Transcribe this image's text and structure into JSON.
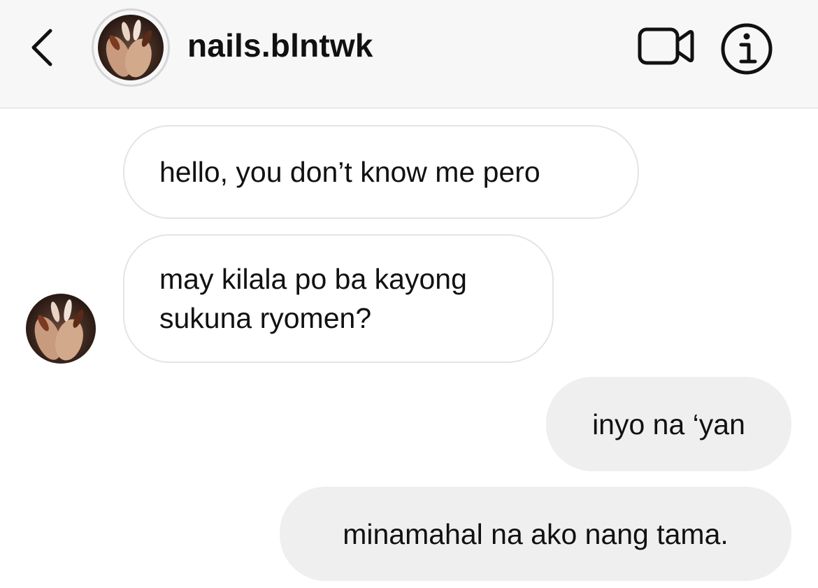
{
  "header": {
    "username": "nails.blntwk",
    "back_icon": "chevron-left-icon",
    "video_icon": "video-camera-icon",
    "info_icon": "info-icon"
  },
  "conversation": {
    "messages": [
      {
        "direction": "incoming",
        "lines": [
          "hello, you don’t know me pero"
        ]
      },
      {
        "direction": "incoming",
        "lines": [
          "may kilala po ba kayong",
          "sukuna ryomen?"
        ]
      },
      {
        "direction": "outgoing",
        "lines": [
          "inyo na ‘yan"
        ]
      },
      {
        "direction": "outgoing",
        "lines": [
          "minamahal na ako nang tama."
        ]
      }
    ]
  },
  "colors": {
    "header_bg": "#f7f7f7",
    "incoming_bubble_bg": "#ffffff",
    "incoming_bubble_border": "#e4e4e4",
    "outgoing_bubble_bg": "#efefef",
    "text": "#111111"
  }
}
